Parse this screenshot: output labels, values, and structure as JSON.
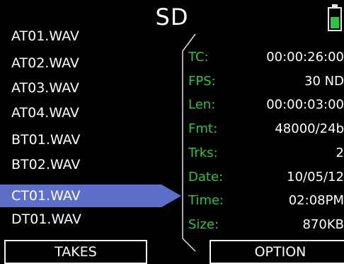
{
  "header": {
    "title": "SD",
    "battery_level": 0.52,
    "battery_color": "#2ec24a"
  },
  "files": [
    {
      "name": "AT01.WAV",
      "selected": false
    },
    {
      "name": "AT02.WAV",
      "selected": false
    },
    {
      "name": "AT03.WAV",
      "selected": false
    },
    {
      "name": "AT04.WAV",
      "selected": false
    },
    {
      "name": "BT01.WAV",
      "selected": false
    },
    {
      "name": "BT02.WAV",
      "selected": false
    },
    {
      "name": "CT01.WAV",
      "selected": true
    },
    {
      "name": "DT01.WAV",
      "selected": false
    }
  ],
  "details": [
    {
      "label": "TC:",
      "value": "00:00:26:00"
    },
    {
      "label": "FPS:",
      "value": "30 ND"
    },
    {
      "label": "Len:",
      "value": "00:00:03:00"
    },
    {
      "label": "Fmt:",
      "value": "48000/24b"
    },
    {
      "label": "Trks:",
      "value": "2"
    },
    {
      "label": "Date:",
      "value": "10/05/12"
    },
    {
      "label": "Time:",
      "value": "02:08PM"
    },
    {
      "label": "Size:",
      "value": "870KB"
    }
  ],
  "buttons": {
    "takes": "TAKES",
    "option": "OPTION"
  },
  "colors": {
    "label_green": "#2fc33e",
    "selection_blue": "#5d6fc8",
    "background": "#000000"
  }
}
